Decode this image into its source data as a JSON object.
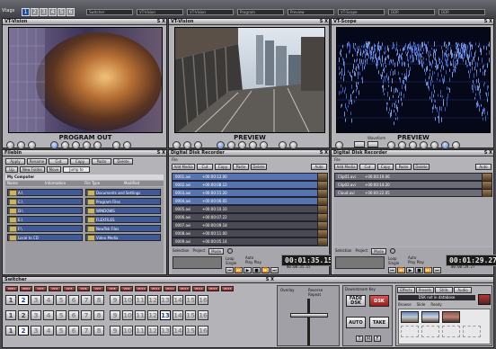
{
  "top": {
    "app_label": "Vtags",
    "tabs": [
      "1",
      "2",
      "3",
      "4",
      "5",
      "6"
    ],
    "slots": [
      "Switcher",
      "VT-Vision",
      "VT-Vision",
      "Program",
      "Preview",
      "VT-Scope",
      "DDR",
      "DDR"
    ]
  },
  "monitors": [
    {
      "title": "VT-Vision",
      "label": "PROGRAM OUT",
      "close": "S X",
      "knobs": [
        "Bright",
        "Cntrst",
        "Sat",
        "Hue",
        "Safe",
        "Marker",
        "Zoom",
        "Pan",
        "Scan",
        "Gain",
        "Edge"
      ]
    },
    {
      "title": "VT-Vision",
      "label": "PREVIEW",
      "close": "S X",
      "knobs": [
        "Bright",
        "Cntrst",
        "Sat",
        "Hue",
        "Safe",
        "Marker",
        "Zoom",
        "Pan",
        "Scan",
        "Gain",
        "Edge"
      ]
    },
    {
      "title": "VT-Scope",
      "label": "PREVIEW",
      "close": "S X",
      "knobs": [
        "Bright",
        "Scope",
        "Input",
        "YC",
        "Y",
        "Cr/Cb",
        "RGB",
        "Lum",
        "RGB",
        "Vectorscope",
        "Scale"
      ],
      "knob_values": [
        "Waveform",
        "Full",
        "Parade"
      ]
    }
  ],
  "filebin": {
    "title": "Filebin",
    "close": "S X",
    "buttons": [
      "Apply",
      "Rename",
      "Cut",
      "Copy",
      "Paste",
      "Delete"
    ],
    "mid_buttons": [
      "Up",
      "New Folder",
      "Move",
      "Jump to"
    ],
    "section": "My Computer",
    "columns": [
      "Name",
      "Information",
      "File Type",
      "Modified"
    ],
    "left_items": [
      "A:\\",
      "C:\\",
      "D:\\",
      "E:\\",
      "F:\\",
      "Local to CD"
    ],
    "right_items": [
      "Documents and Settings",
      "Program Files",
      "WINDOWS",
      "FLEXFILES",
      "NewTek Files",
      "Video Media"
    ]
  },
  "ddr1": {
    "title": "Digital Disk Recorder",
    "close": "S X",
    "file_label": "File",
    "buttons": [
      "Add Media",
      "Cut",
      "Copy",
      "Paste",
      "Delete"
    ],
    "extra": "Auto",
    "clips": [
      "0001.avi",
      "0002.avi",
      "0003.avi",
      "0004.avi",
      "0005.avi",
      "0006.avi",
      "0007.avi",
      "0008.avi",
      "0009.avi"
    ],
    "timecodes": [
      "+00:00:12.00",
      "+00:00:08.12",
      "+00:00:15.20",
      "+00:00:06.05",
      "+00:00:10.10",
      "+00:00:07.22",
      "+00:00:09.18",
      "+00:00:11.00",
      "+00:00:05.14"
    ],
    "controls": [
      "Selection",
      "Project",
      "Mode"
    ],
    "options": [
      "Loop",
      "Single",
      "Auto",
      "Play Play",
      "Auto Play"
    ],
    "timecode": "00:01:35.15",
    "sub_timecode": "00:00:35.15",
    "rate": "1.0"
  },
  "ddr2": {
    "title": "Digital Disk Recorder",
    "close": "S X",
    "file_label": "File",
    "buttons": [
      "Add Media",
      "Cut",
      "Copy",
      "Paste",
      "Delete"
    ],
    "extra": "Auto",
    "clips": [
      "Clip01.avi",
      "Clip02.avi",
      "Cloud.avi"
    ],
    "timecodes": [
      "+00:00:19.06",
      "+00:00:14.20",
      "+00:00:22.05"
    ],
    "controls": [
      "Selection",
      "Project",
      "Mode"
    ],
    "options": [
      "Loop",
      "Single",
      "Auto",
      "Play Play",
      "Auto Play"
    ],
    "timecode": "00:01:29.27",
    "sub_timecode": "00:00:29.27",
    "rate": "1.0"
  },
  "switcher": {
    "title": "Switcher",
    "close": "S X",
    "red_row": [
      "DDR1",
      "DDR2",
      "VID3",
      "VID4",
      "VID5",
      "VID6",
      "VID7",
      "VID8",
      "VID9",
      "VID10",
      "VID11",
      "VID12",
      "VID13",
      "VID14",
      "VID15",
      "VID16"
    ],
    "rows": [
      {
        "label": "PGM",
        "buttons": [
          "1",
          "2",
          "3",
          "4",
          "5",
          "6",
          "7",
          "8",
          "9",
          "10",
          "11",
          "12",
          "13",
          "14",
          "15",
          "16"
        ],
        "active": "2"
      },
      {
        "label": "PRV",
        "buttons": [
          "1",
          "2",
          "3",
          "4",
          "5",
          "6",
          "7",
          "8",
          "9",
          "10",
          "11",
          "12",
          "13",
          "14",
          "15",
          "16"
        ],
        "active": "13"
      },
      {
        "label": "KEY",
        "buttons": [
          "1",
          "2",
          "3",
          "4",
          "5",
          "6",
          "7",
          "8",
          "9",
          "10",
          "11",
          "12",
          "13",
          "14",
          "15",
          "16"
        ],
        "active": "2"
      }
    ],
    "tbar_labels": [
      "Overlay",
      "Reverse",
      "Repeat"
    ],
    "trans_title": "Downstream Key",
    "trans_buttons": [
      "FADE",
      "DSK",
      "AUTO",
      "TAKE"
    ],
    "small_btns": [
      "T",
      "M",
      "F"
    ]
  },
  "thumbs": {
    "tabs": [
      "Effects",
      "Presets",
      "Stills",
      "Audio"
    ],
    "bar": "DSK not in database",
    "checks": [
      "Browse",
      "Slide",
      "Ready"
    ]
  }
}
